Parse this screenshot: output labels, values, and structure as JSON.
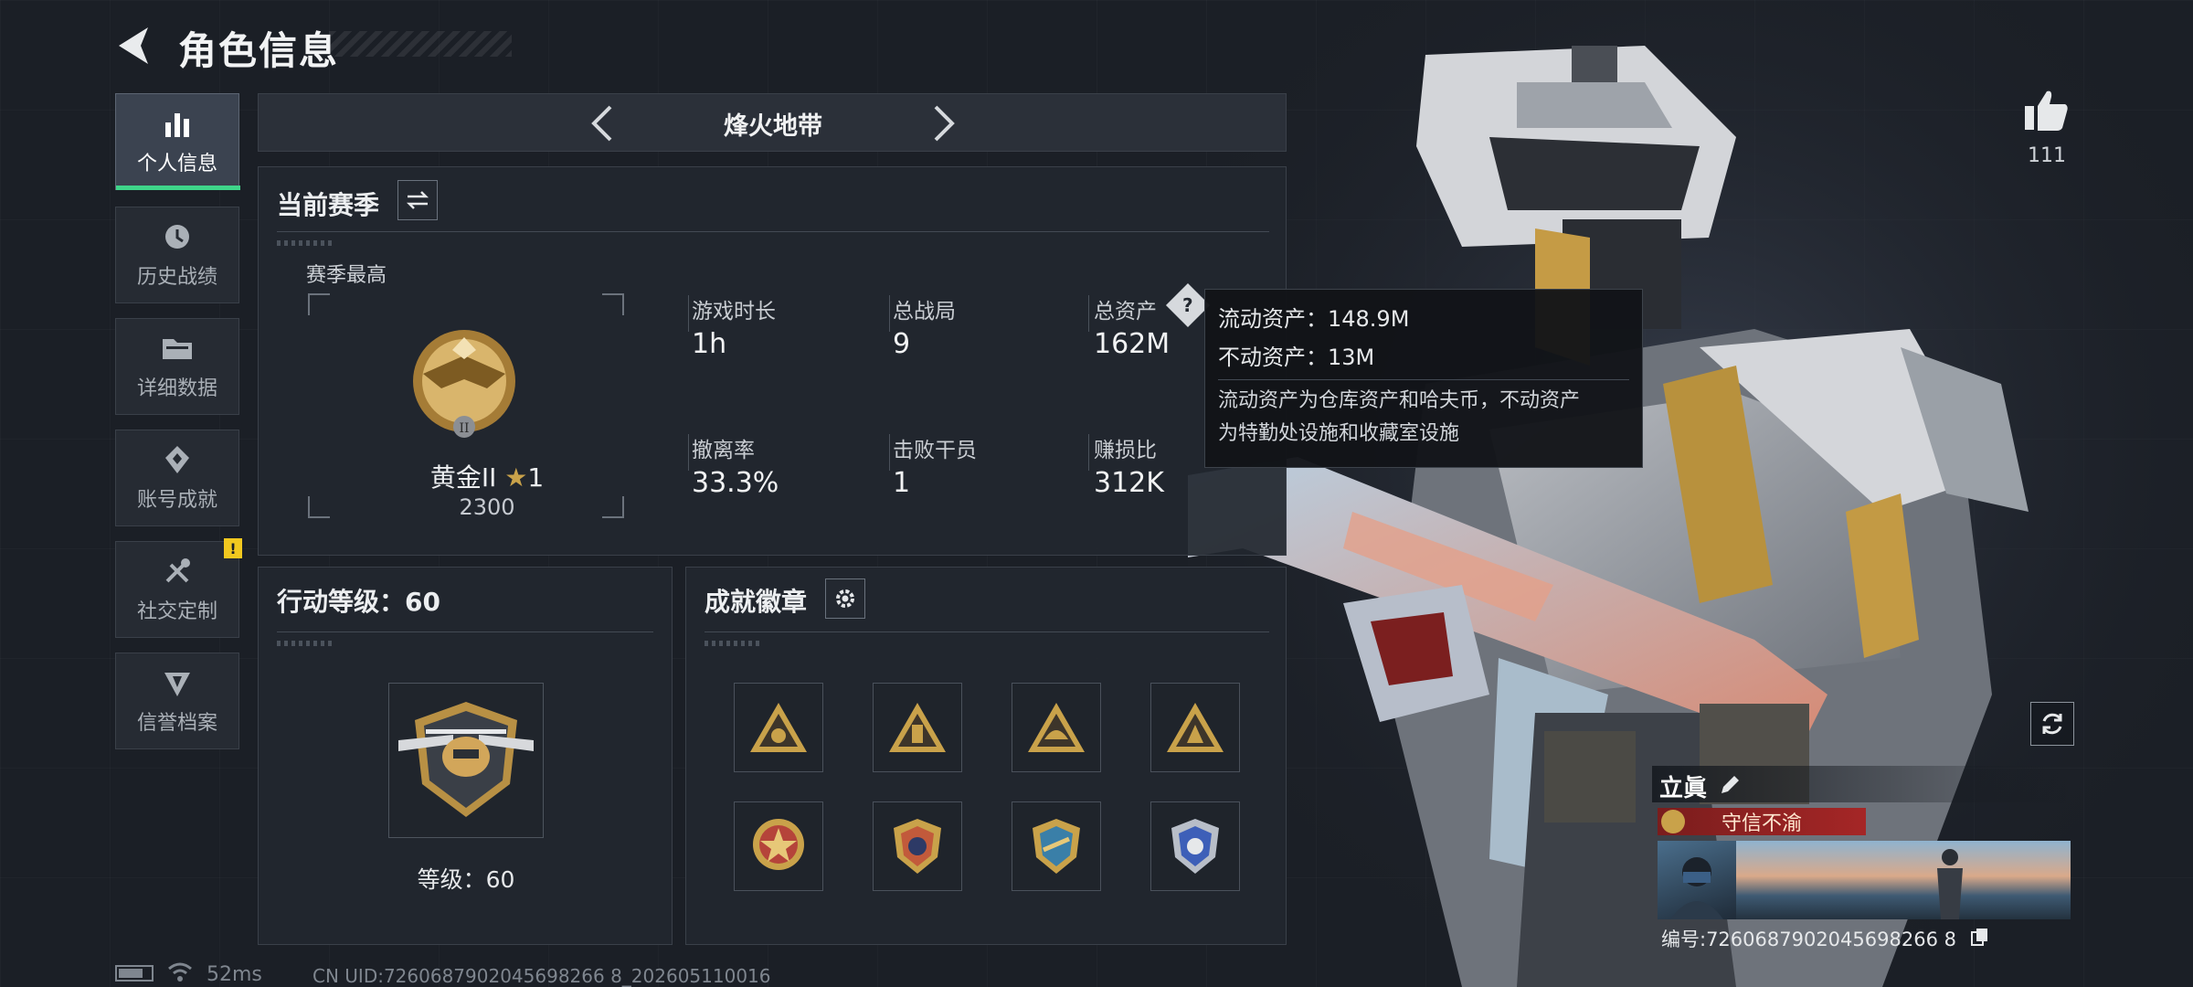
{
  "header": {
    "title": "角色信息"
  },
  "sidebar": {
    "items": [
      {
        "label": "个人信息",
        "icon": "bar-chart-icon",
        "active": true
      },
      {
        "label": "历史战绩",
        "icon": "history-icon"
      },
      {
        "label": "详细数据",
        "icon": "folder-icon"
      },
      {
        "label": "账号成就",
        "icon": "achievement-icon"
      },
      {
        "label": "社交定制",
        "icon": "tools-icon",
        "badge": "!"
      },
      {
        "label": "信誉档案",
        "icon": "shield-icon"
      }
    ]
  },
  "mode_bar": {
    "title": "烽火地带"
  },
  "season": {
    "title": "当前赛季",
    "best_label": "赛季最高",
    "rank_name": "黄金II",
    "rank_stars": "1",
    "rank_points": "2300",
    "stats": [
      {
        "label": "游戏时长",
        "value": "1h"
      },
      {
        "label": "总战局",
        "value": "9"
      },
      {
        "label": "总资产",
        "value": "162M",
        "help": "?"
      },
      {
        "label": "撤离率",
        "value": "33.3%"
      },
      {
        "label": "击败干员",
        "value": "1"
      },
      {
        "label": "赚损比",
        "value": "312K"
      }
    ]
  },
  "tooltip": {
    "line1": "流动资产：148.9M",
    "line2": "不动资产：13M",
    "desc1": "流动资产为仓库资产和哈夫币，不动资产",
    "desc2": "为特勤处设施和收藏室设施"
  },
  "level": {
    "title": "行动等级：60",
    "label": "等级：60"
  },
  "badges": {
    "title": "成就徽章",
    "items": [
      {
        "icon": "triangle-badge-icon",
        "color": "#c9a24a"
      },
      {
        "icon": "triangle-badge-icon",
        "color": "#c9a24a"
      },
      {
        "icon": "triangle-badge-icon",
        "color": "#c9a24a"
      },
      {
        "icon": "triangle-badge-icon",
        "color": "#c9a24a"
      },
      {
        "icon": "round-badge-icon",
        "color": "#b5443a"
      },
      {
        "icon": "shield-badge-icon",
        "color": "#c25a3b"
      },
      {
        "icon": "crest-badge-icon",
        "color": "#3a7fa8"
      },
      {
        "icon": "crest-badge-icon",
        "color": "#3d5fb8"
      }
    ]
  },
  "likes": {
    "count": "111"
  },
  "card": {
    "name": "立眞",
    "title": "守信不渝",
    "id": "编号:7260687902045698266 8"
  },
  "status": {
    "ping": "52ms",
    "uid": "CN UID:7260687902045698266 8_202605110016"
  },
  "colors": {
    "accent": "#3fd58a",
    "warning": "#f2c81f",
    "title_red": "#a52626"
  }
}
